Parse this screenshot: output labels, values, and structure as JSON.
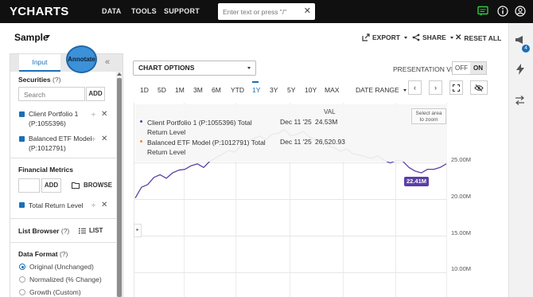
{
  "app": {
    "logo": "YCHARTS",
    "nav": [
      "DATA",
      "TOOLS",
      "SUPPORT"
    ],
    "search_placeholder": "Enter text or press \"/\"",
    "search_clear": "✕"
  },
  "header": {
    "title": "Sample",
    "export_label": "EXPORT",
    "share_label": "SHARE",
    "reset_label": "RESET ALL",
    "notification_count": "4"
  },
  "left_panel": {
    "tab_input": "Input",
    "tab_annotate": "Annotate",
    "collapse": "«",
    "securities_label": "Securities",
    "help_mark": "(?)",
    "search_placeholder": "Search",
    "add_label": "ADD",
    "securities": [
      {
        "line1": "Client Portfolio 1",
        "line2": "(P:1055396)"
      },
      {
        "line1": "Balanced ETF Model",
        "line2": "(P:1012791)"
      }
    ],
    "metrics_label": "Financial Metrics",
    "metrics_add": "ADD",
    "browse_label": "BROWSE",
    "metric": "Total Return Level",
    "list_browser_label": "List Browser",
    "list_label": "LIST",
    "data_format_label": "Data Format",
    "formats": [
      "Original (Unchanged)",
      "Normalized (% Change)",
      "Growth (Custom)"
    ],
    "selected_format": "Original (Unchanged)"
  },
  "chart_controls": {
    "chart_options": "CHART OPTIONS",
    "presentation_view": "PRESENTATION VIEW",
    "off": "OFF",
    "on": "ON",
    "ranges": [
      "1D",
      "5D",
      "1M",
      "3M",
      "6M",
      "YTD",
      "1Y",
      "3Y",
      "5Y",
      "10Y",
      "MAX"
    ],
    "active_range": "1Y",
    "date_range": "DATE RANGE",
    "zoom_hint_1": "Select area",
    "zoom_hint_2": "to zoom"
  },
  "legend": {
    "val_header": "VAL",
    "rows": [
      {
        "name1": "Client Portfolio 1 (P:1055396) Total",
        "name2": "Return Level",
        "date": "Dec 11 '25",
        "value": "24.53M",
        "color": "#5c3fa6"
      },
      {
        "name1": "Balanced ETF Model (P:1012791) Total",
        "name2": "Return Level",
        "date": "Dec 11 '25",
        "value": "26,520.93",
        "color": "#f08a24"
      }
    ]
  },
  "chart_data": {
    "type": "line",
    "y_ticks": [
      "25.00M",
      "20.00M",
      "15.00M",
      "10.00M"
    ],
    "ylim": [
      6.7,
      28.3
    ],
    "series": [
      {
        "name": "Client Portfolio 1 (P:1055396) Total Return Level",
        "color": "#5c3fa6",
        "values": [
          17.7,
          18.9,
          19.2,
          20.0,
          20.3,
          19.9,
          20.5,
          20.8,
          20.9,
          21.3,
          21.5,
          21.1,
          21.8,
          22.2,
          22.6,
          23.0,
          22.8,
          23.5,
          24.0,
          24.3,
          24.6,
          24.2,
          24.8,
          24.9,
          25.3,
          24.6,
          24.8,
          25.1,
          24.5,
          24.2,
          24.1,
          23.5,
          23.3,
          22.9,
          23.2,
          22.6,
          22.5,
          22.3,
          22.1,
          22.4,
          21.9,
          21.6,
          21.9,
          21.8,
          21.1,
          20.7,
          20.5,
          20.9,
          20.9,
          21.1,
          21.5
        ]
      }
    ],
    "badge": "22.41M"
  }
}
